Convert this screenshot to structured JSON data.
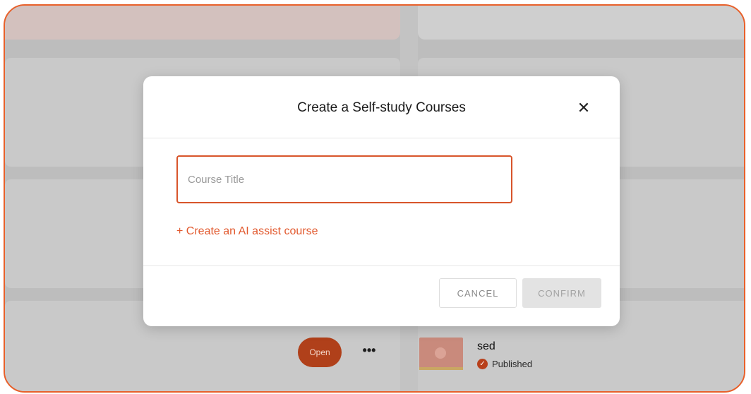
{
  "modal": {
    "title": "Create a Self-study Courses",
    "close_icon": "close-icon",
    "input_placeholder": "Course Title",
    "input_value": "",
    "ai_assist_link": "+ Create an AI assist course",
    "cancel_label": "CANCEL",
    "confirm_label": "CONFIRM"
  },
  "background": {
    "open_label": "Open",
    "more_label": "•••",
    "course": {
      "name": "sed",
      "status": "Published",
      "status_icon": "check-circle-icon"
    }
  },
  "colors": {
    "accent": "#e2592e",
    "frame_border": "#e8602a",
    "open_button": "#b0401a"
  }
}
